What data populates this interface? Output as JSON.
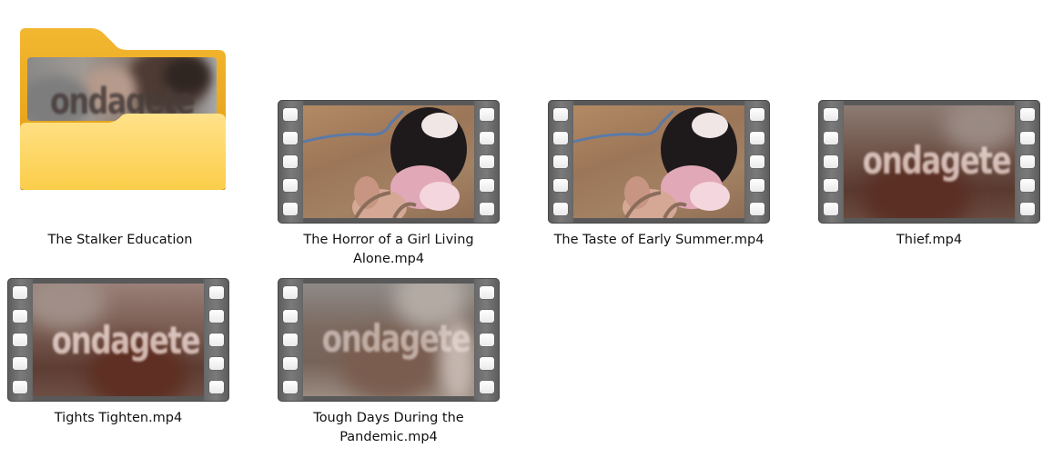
{
  "items": [
    {
      "name": "The Stalker Education",
      "type": "folder",
      "icon": "folder-icon",
      "preview_text": "ondagete"
    },
    {
      "name": "The Horror of a Girl Living Alone.mp4",
      "type": "video",
      "icon": "video-file-icon"
    },
    {
      "name": "The Taste of Early Summer.mp4",
      "type": "video",
      "icon": "video-file-icon"
    },
    {
      "name": "Thief.mp4",
      "type": "video",
      "icon": "video-file-icon",
      "preview_text": "ondagete"
    },
    {
      "name": "Tights Tighten.mp4",
      "type": "video",
      "icon": "video-file-icon",
      "preview_text": "ondagete"
    },
    {
      "name": "Tough Days During the Pandemic.mp4",
      "type": "video",
      "icon": "video-file-icon",
      "preview_text": "ondagete"
    }
  ],
  "colors": {
    "folder_back": "#f0b429",
    "folder_front": "#ffd96a",
    "film_body": "#595959",
    "background": "#ffffff"
  }
}
